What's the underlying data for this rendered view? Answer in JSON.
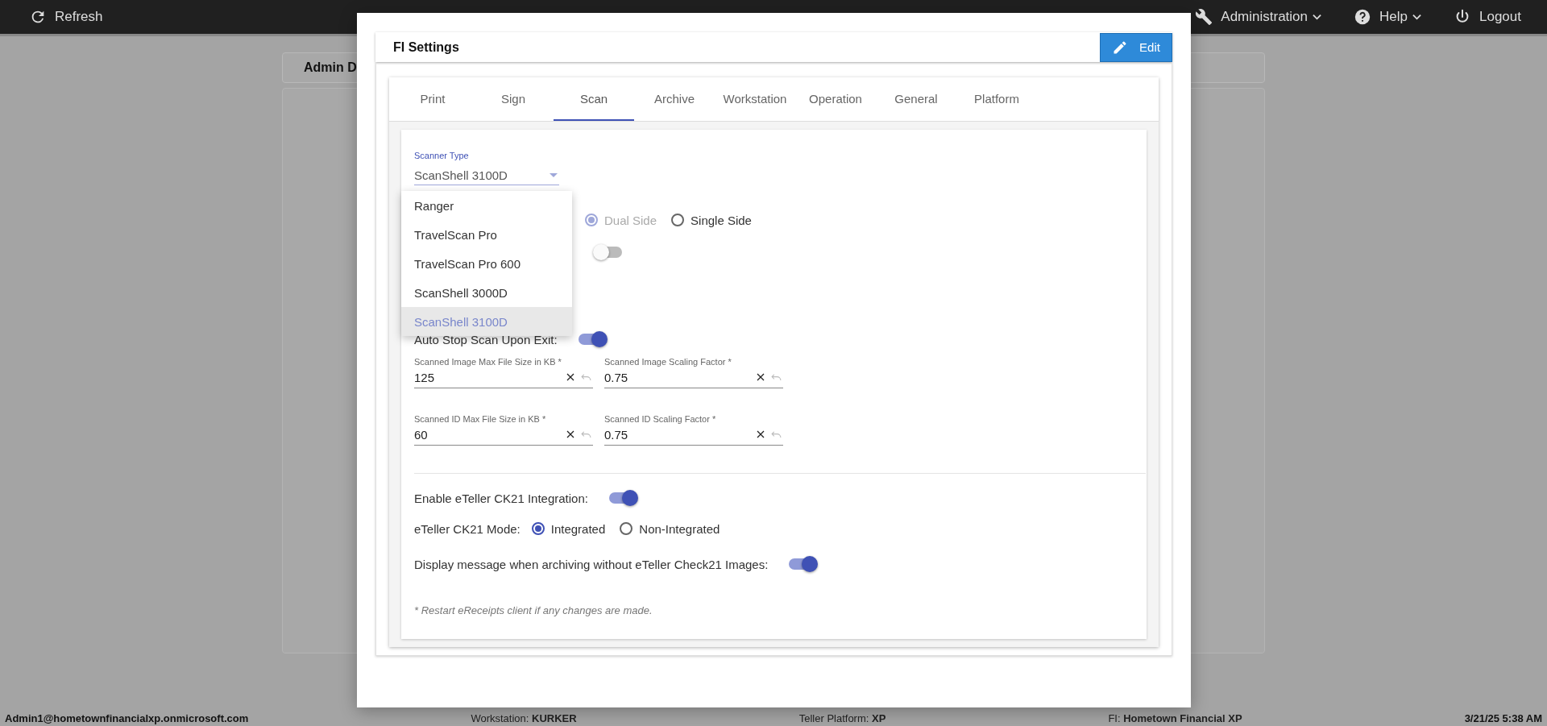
{
  "top_bar": {
    "refresh": "Refresh",
    "menus": [
      {
        "label": "Administration",
        "kind": "admin"
      },
      {
        "label": "Help",
        "kind": "help"
      }
    ],
    "logout": "Logout"
  },
  "background": {
    "card_title": "Admin D"
  },
  "dialog": {
    "title": "FI Settings",
    "edit_button": "Edit",
    "tabs": [
      {
        "label": "Print",
        "selected": false
      },
      {
        "label": "Sign",
        "selected": false
      },
      {
        "label": "Scan",
        "selected": true
      },
      {
        "label": "Archive",
        "selected": false
      },
      {
        "label": "Workstation",
        "selected": false
      },
      {
        "label": "Operation",
        "selected": false
      },
      {
        "label": "General",
        "selected": false
      },
      {
        "label": "Platform",
        "selected": false
      }
    ],
    "scanner_type": {
      "label": "Scanner Type",
      "value": "ScanShell 3100D",
      "options": [
        {
          "label": "Ranger",
          "selected": false
        },
        {
          "label": "TravelScan Pro",
          "selected": false
        },
        {
          "label": "TravelScan Pro 600",
          "selected": false
        },
        {
          "label": "ScanShell 3000D",
          "selected": false
        },
        {
          "label": "ScanShell 3100D",
          "selected": true
        }
      ]
    },
    "scan_side": {
      "options": [
        {
          "label": "Dual Side",
          "selected": true
        },
        {
          "label": "Single Side",
          "selected": false
        }
      ]
    },
    "partly_hidden_toggle": {
      "on": false
    },
    "auto_stop": {
      "label": "Auto Stop Scan Upon Exit:",
      "on": true
    },
    "size_fields": [
      {
        "label": "Scanned Image Max File Size in KB *",
        "value": "125"
      },
      {
        "label": "Scanned Image Scaling Factor *",
        "value": "0.75"
      },
      {
        "label": "Scanned ID Max File Size in KB *",
        "value": "60"
      },
      {
        "label": "Scanned ID Scaling Factor *",
        "value": "0.75"
      }
    ],
    "ck21_integration": {
      "label": "Enable eTeller CK21 Integration:",
      "on": true
    },
    "ck21_mode": {
      "label": "eTeller CK21 Mode:",
      "options": [
        {
          "label": "Integrated",
          "selected": true
        },
        {
          "label": "Non-Integrated",
          "selected": false
        }
      ]
    },
    "display_message": {
      "label": "Display message when archiving without eTeller Check21 Images:",
      "on": true
    },
    "footnote": "* Restart eReceipts client if any changes are made."
  },
  "status_bar": {
    "user": "Admin1@hometownfinancialxp.onmicrosoft.com",
    "items": [
      {
        "label": "Workstation:",
        "value": "KURKER"
      },
      {
        "label": "Teller Platform:",
        "value": "XP"
      },
      {
        "label": "FI:",
        "value": "Hometown Financial XP"
      }
    ],
    "datetime": "3/21/25 5:38 AM"
  }
}
